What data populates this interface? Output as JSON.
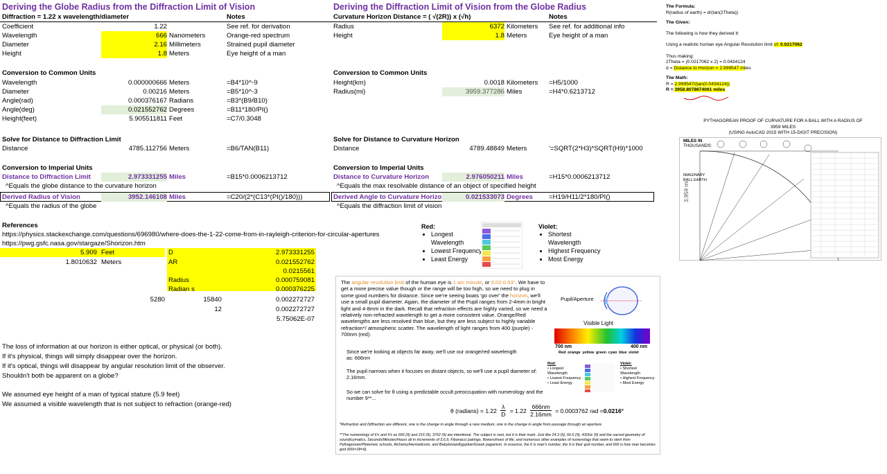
{
  "left": {
    "title": "Deriving the Globe Radius from the Diffraction Limit of Vision",
    "header": {
      "formula": "Diffraction = 1.22 x wavelength/diameter",
      "notes": "Notes"
    },
    "rows": [
      {
        "label": "Coefficient",
        "value": "1.22",
        "unit": "",
        "note": "See ref. for derivation"
      },
      {
        "label": "Wavelength",
        "value": "666",
        "unit": "Nanometers",
        "note": "Orange-red spectrum"
      },
      {
        "label": "Diameter",
        "value": "2.16",
        "unit": "Millimeters",
        "note": "Strained pupil diameter"
      },
      {
        "label": "Height",
        "value": "1.8",
        "unit": "Meters",
        "note": "Eye height of a man"
      }
    ],
    "conversion_title": "Conversion to Common Units",
    "conversion_rows": [
      {
        "label": "Wavelength",
        "value": "0.000000666",
        "unit": "Meters",
        "note": "=B4*10^-9"
      },
      {
        "label": "Diameter",
        "value": "0.00216",
        "unit": "Meters",
        "note": "=B5*10^-3"
      },
      {
        "label": "Angle(rad)",
        "value": "0.000376167",
        "unit": "Radians",
        "note": "=B3*(B9/B10)"
      },
      {
        "label": "Angle(deg)",
        "value": "0.021552762",
        "unit": "Degrees",
        "note": "=B11*180/PI()"
      },
      {
        "label": "Height(feet)",
        "value": "5.905511811",
        "unit": "Feet",
        "note": "=C7/0.3048"
      }
    ],
    "solve_title": "Solve for Distance to Diffraction Limit",
    "solve_row": {
      "label": "Distance",
      "value": "4785.112756",
      "unit": "Meters",
      "note": "=B6/TAN(B11)"
    },
    "imperial_title": "Conversion to Imperial Units",
    "imperial_row": {
      "label": "Distance to Diffraction Limit",
      "value": "2.973331255",
      "unit": "Miles",
      "note": "=B15*0.0006213712"
    },
    "imperial_caption": "^Equals the globe distance to the curvature horizon",
    "derived_row": {
      "label": "Derived Radius of Vision",
      "value": "3952.146108",
      "unit": "Miles",
      "note": "=C20/(2*(C13*(PI()/180)))"
    },
    "derived_caption": "^Equals the radius of the globe",
    "references_title": "References",
    "references": [
      "https://physics.stackexchange.com/questions/696980/where-does-the-1-22-come-from-in-rayleigh-criterion-for-circular-apertures",
      "https://pwg.gsfc.nasa.gov/stargaze/Shorizon.htm"
    ],
    "scratch": {
      "feet_value": "5.909",
      "feet_unit": "Feet",
      "meters_value": "1.8010632",
      "meters_unit": "Meters",
      "labels": [
        "D",
        "AR",
        "",
        "Radius",
        "Radian s"
      ],
      "values": [
        "2.973331255",
        "0.021552762",
        "0.0215561",
        "0.000759081",
        "0.000376225",
        "0.002272727",
        "0.002272727",
        "5.75062E-07"
      ],
      "n1": "5280",
      "n2": "15840",
      "n3": "12"
    },
    "paragraph1": [
      "The loss of information at our horizon is either optical, or physical (or both).",
      "If it's physical, things will simply disappear over the horizon.",
      "If it's optical, things will disappear by angular resolution limit of the observer.",
      "Shouldn't both be apparent on a globe?"
    ],
    "paragraph2": [
      "We assumed eye height of a man of typical stature (5.9 feet)",
      "We assumed a visible wavelength that is not subject to refraction (orange-red)"
    ]
  },
  "middle": {
    "title": "Deriving the Diffraction Limit of Vision from the Globe Radius",
    "header": {
      "formula": "Curvature Horizon Distance = ( √(2R)) x (√h)",
      "notes": "Notes"
    },
    "rows": [
      {
        "label": "Radius",
        "value": "6372",
        "unit": "Kilometers",
        "note": "See ref. for additional info"
      },
      {
        "label": "Height",
        "value": "1.8",
        "unit": "Meters",
        "note": "Eye height of a man"
      }
    ],
    "conversion_title": "Conversion to Common Units",
    "conversion_rows": [
      {
        "label": "Height(km)",
        "value": "0.0018",
        "unit": "Kilometers",
        "note": "=H5/1000"
      },
      {
        "label": "Radius(mi)",
        "value": "3959.377286",
        "unit": "Miles",
        "note": "=H4*0.6213712"
      }
    ],
    "solve_title": "Solve for Distance to Curvature Horizon",
    "solve_row": {
      "label": "Distance",
      "value": "4789.48849",
      "unit": "Meters",
      "note": "'=SQRT(2*H3)*SQRT(H9)*1000"
    },
    "imperial_title": "Conversion to Imperial Units",
    "imperial_row": {
      "label": "Distance to Curvature Horizon",
      "value": "2.976050211",
      "unit": "Miles",
      "note": "=H15*0.0006213712"
    },
    "imperial_caption": "^Equals the max resolvable distance of an object of specified height",
    "derived_row": {
      "label": "Derived Angle to Curvature Horizon",
      "value": "0.021533073",
      "unit": "Degrees",
      "note": "=H19/H11/2*180/PI()"
    },
    "derived_caption": "^Equals the diffraction limit of vision"
  },
  "spectrum_top": {
    "red_title": "Red:",
    "red_items": [
      "Longest Wavelength",
      "Lowest Frequency",
      "Least Energy"
    ],
    "violet_title": "Violet:",
    "violet_items": [
      "Shortest Wavelength",
      "Highest Frequency",
      "Most Energy"
    ]
  },
  "panel": {
    "p1_a": "The ",
    "p1_hl1": "angular resolution limit",
    "p1_b": " of the human eye is ",
    "p1_hl2": "1 arc minute",
    "p1_c": ", or ",
    "p1_hl3": "0.02-0.03°",
    "p1_d": ". We have to get a more precise value though or the range will be too high, so we need to plug in some good numbers for distance.  Since we're seeing boats 'go over' the ",
    "p1_hl4": "horizon",
    "p1_e": ", we'll use a small pupil diameter.  Again, the diameter of the Pupil ranges from 2-4mm in bright light and 4-8mm in the dark.  Recall that refraction effects are highly varied, so we need a relatively non-refracted wavelength to get a more consistent value.  Orange/Red wavelengths are less resolved than blue, but they are less subject to highly variable refraction*/ atmospheric scatter.  The wavelength of light ranges from 400 (purple) - 700nm (red).",
    "p2": "Since we're looking at objects far away, we'll use our orange/red wavelength as: 666nm",
    "p3": "The pupil narrows when it focuses on distant objects, so we'll use a pupil diameter of: 2.16mm.",
    "p4": "So we can solve for θ using a predictable occult preoccupation with numerology and the number 9**...",
    "pupil_label": "Pupil/Aperture",
    "visible_light": "Visible Light",
    "nm700": "700 nm",
    "nm400": "400 nm",
    "colors": "Red  orange  yellow  green  cyan  blue  violet",
    "eq_lhs": "θ (radians) = 1.22",
    "eq_frac_num": "λ",
    "eq_frac_den": "D",
    "eq_mid": "= 1.22",
    "eq_num": "666nm",
    "eq_den": "2.16mm",
    "eq_rhs": "= 0.0003762 rad = ",
    "eq_result": "0.0216°",
    "footnote1": "*Refraction and Diffraction are different, one is the change in angle through a new medium, one is the change in angle from passage through an aperture",
    "footnote2": "**The numerology of 6's and 9's as 666 (9) and 216 (9), 3762 (9) are intentional.  The subject is vast, but it is their mark.  Just like 24.3 (9), 66.6 (9), 432Hz (9) and the sacred geometry of sound/cymatics, Seconds/Minutes/Hours all in increments of 3,6,9, Fibonacci pairings, flowers/trees of life, and numerous other examples of numerology that seem to stem from Pythagorean/Ptolemeic schools, Alchemy/Hermeticism, and Babylonian/Egyptian/Greek paganism.  In essence, the 6 is man's number, the 9 is their god number, and 666 is how man becomes god (666=18=9).",
    "red_title": "Red:",
    "red_items": [
      "Longest Wavelength",
      "Lowest Frequency",
      "Least Energy"
    ],
    "violet_title": "Violet:",
    "violet_items": [
      "Shortest Wavelength",
      "Highest Frequency",
      "Most Energy"
    ]
  },
  "right": {
    "formula_title": "The Formula:",
    "formula": "R(radius of earth) = d/(tan(2Theta))",
    "given_title": "The Given:",
    "derived_intro": "The following is how they derived it:",
    "using_a": "Using a realistic human eye Angular Resolution limit ",
    "using_hl": "of: ",
    "using_val": "0.0217062",
    "thus": "Thus making:",
    "theta2": "2Theta = (0.0217062 x 2) = 0.0434124",
    "d_a": "d = ",
    "d_hl": "Distance to Horizon = 2.999547 mi",
    "d_b": "les",
    "math_title": "The Math:",
    "math1_a": "R = ",
    "math1_hl": "2.999547/(tan(0.0434124))",
    "math2_a": "R = ",
    "math2_hl": "3958.8078674061 miles",
    "proof_title": "PYTHAGOREAN PROOF OF CURVATURE FOR A BALL WITH A RADIUS OF 3959 MILES",
    "proof_sub": "(USING AutoCAD 2015 WITH 15-DIGIT PRECISION)",
    "miles_in": "MILES IN",
    "thousands": "THOUSANDS:",
    "imag": "IMAGINARY BALL EARTH",
    "radius_lbl": "3,959 mi.",
    "accent": "#ffff00"
  }
}
